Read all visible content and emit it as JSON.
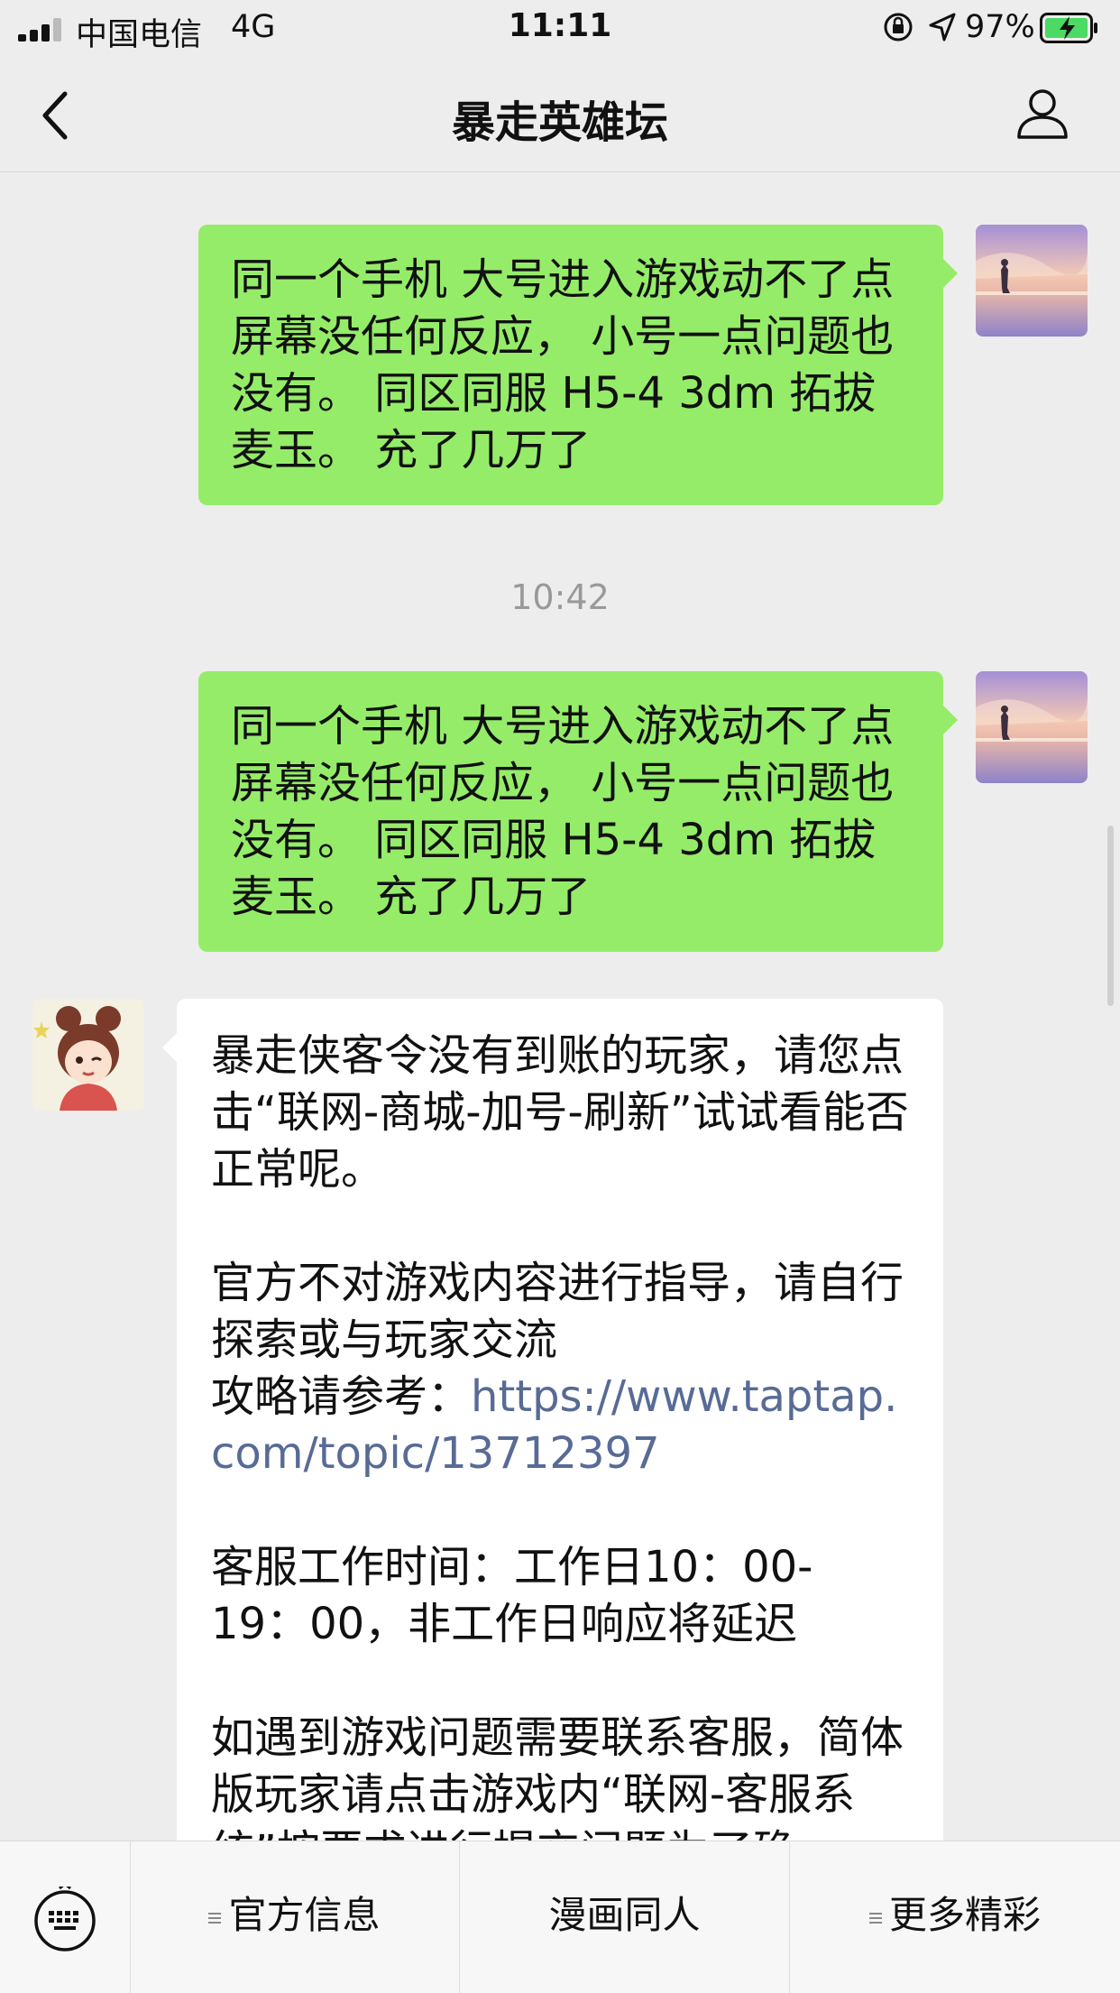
{
  "status": {
    "carrier": "中国电信",
    "network": "4G",
    "time": "11:11",
    "battery_pct": "97%"
  },
  "nav": {
    "title": "暴走英雄坛",
    "back_icon": "chevron-left-icon",
    "profile_icon": "person-icon"
  },
  "messages": {
    "m1": "同一个手机 大号进入游戏动不了点屏幕没任何反应， 小号一点问题也没有。 同区同服 H5-4 3dm 拓拔麦玉。 充了几万了",
    "timestamp": "10:42",
    "m2": "同一个手机 大号进入游戏动不了点屏幕没任何反应， 小号一点问题也没有。 同区同服 H5-4 3dm 拓拔麦玉。 充了几万了",
    "reply": {
      "p1": "暴走侠客令没有到账的玩家，请您点击“联网-商城-加号-刷新”试试看能否正常呢。",
      "p2_line1": "官方不对游戏内容进行指导，请自行探索或与玩家交流",
      "p2_prefix": "攻略请参考：",
      "p2_link": "https://www.taptap.com/topic/13712397",
      "p3": "客服工作时间：工作日10：00-19：00，非工作日响应将延迟",
      "p4": "如遇到游戏问题需要联系客服，简体版玩家请点击游戏内“联网-客服系统”按要求进行提交问题为了确"
    }
  },
  "menu": {
    "keyboard_icon": "keyboard-icon",
    "items": [
      "官方信息",
      "漫画同人",
      "更多精彩"
    ]
  },
  "colors": {
    "sent_bubble": "#95ec69",
    "link": "#576b95",
    "background": "#ededed"
  }
}
